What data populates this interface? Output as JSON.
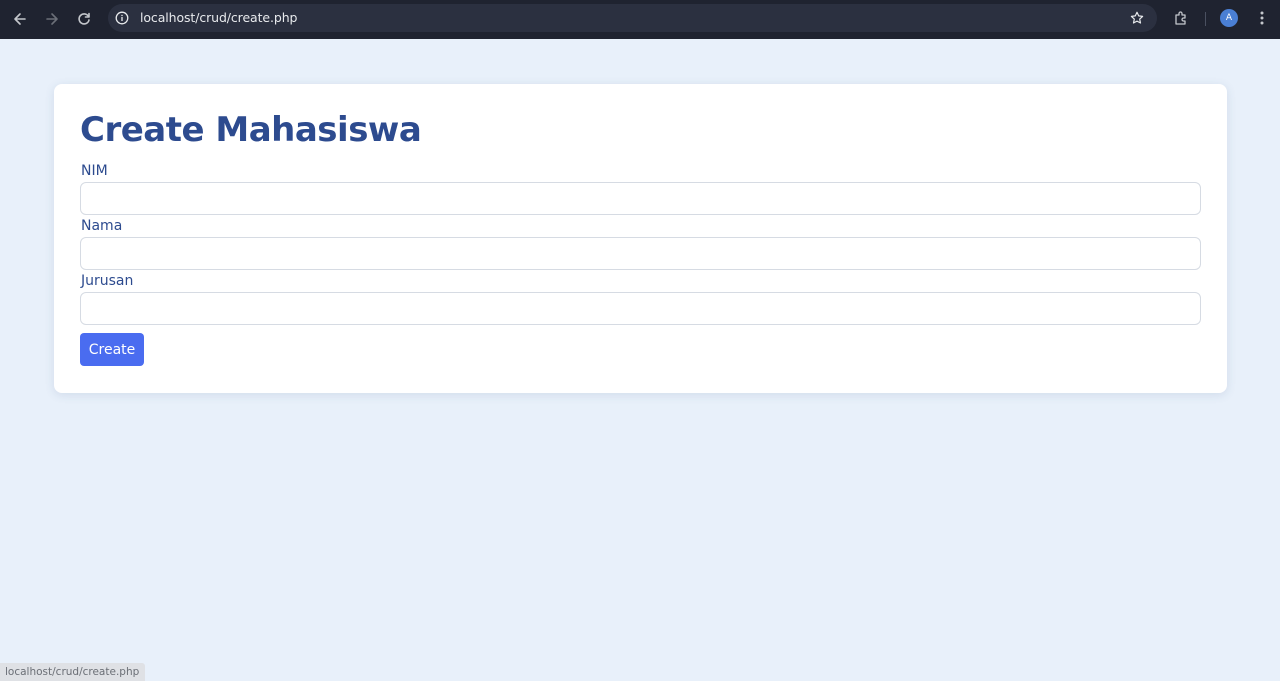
{
  "browser": {
    "url": "localhost/crud/create.php",
    "avatar_letter": "A",
    "status_url": "localhost/crud/create.php",
    "icons": {
      "back": "arrow-left-icon",
      "forward": "arrow-right-icon",
      "reload": "reload-icon",
      "site_info": "info-icon",
      "bookmark": "star-icon",
      "extensions": "puzzle-icon",
      "menu": "kebab-menu-icon"
    }
  },
  "page": {
    "title": "Create Mahasiswa",
    "fields": [
      {
        "label": "NIM",
        "value": "",
        "placeholder": ""
      },
      {
        "label": "Nama",
        "value": "",
        "placeholder": ""
      },
      {
        "label": "Jurusan",
        "value": "",
        "placeholder": ""
      }
    ],
    "submit_label": "Create"
  },
  "colors": {
    "background": "#e8f0fa",
    "title": "#2d4b8f",
    "button": "#4a6cf0",
    "chrome": "#1f2330"
  }
}
